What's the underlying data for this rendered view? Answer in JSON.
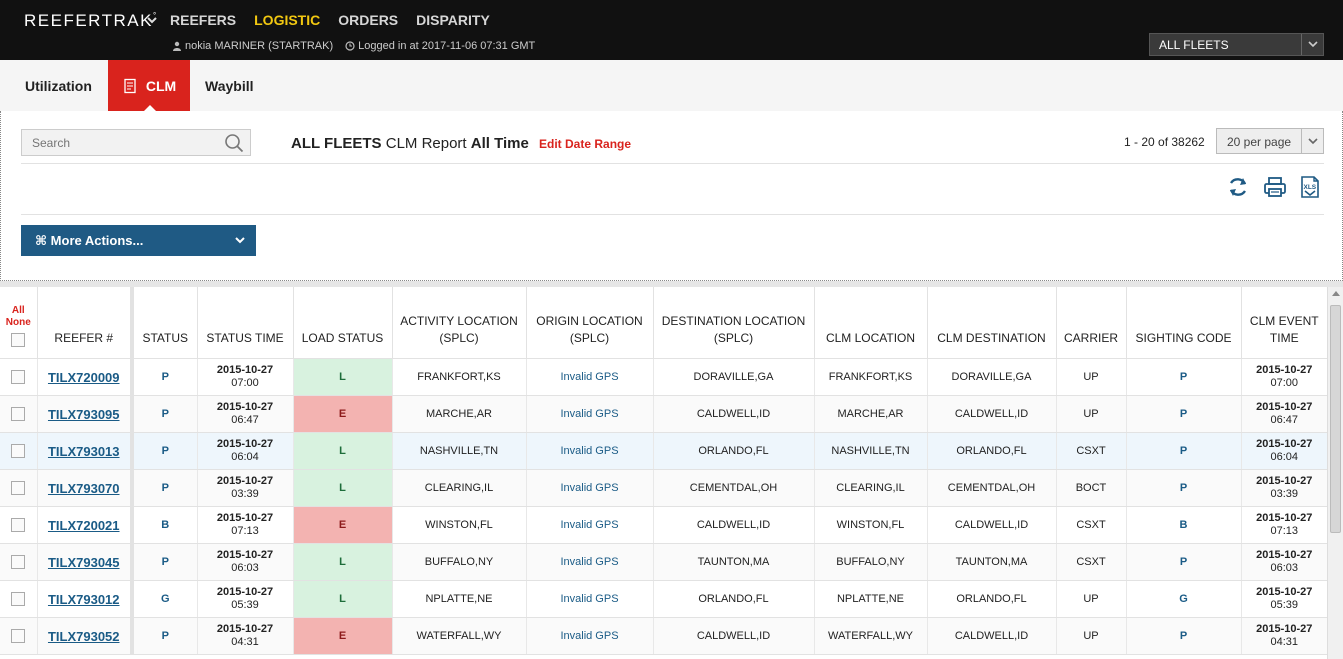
{
  "header": {
    "brand": "REEFERTRAK",
    "brand_mark": "°",
    "nav": [
      "REEFERS",
      "LOGISTIC",
      "ORDERS",
      "DISPARITY"
    ],
    "active_nav": "LOGISTIC",
    "user": "nokia MARINER (STARTRAK)",
    "login": "Logged in at 2017-11-06 07:31 GMT",
    "fleet_select": "ALL FLEETS"
  },
  "tabs": {
    "utilization": "Utilization",
    "clm": "CLM",
    "waybill": "Waybill",
    "active": "CLM"
  },
  "toolbar": {
    "search_placeholder": "Search",
    "title_fleet": "ALL FLEETS",
    "title_mid": "CLM Report",
    "title_range": "All Time",
    "edit_range": "Edit Date Range",
    "pager": "1 - 20 of 38262",
    "per_page": "20 per page",
    "more_actions": "⌘ More Actions..."
  },
  "table": {
    "select_all": "All",
    "select_none": "None",
    "headers": {
      "reefer": "REEFER #",
      "status": "STATUS",
      "status_time": "STATUS TIME",
      "load_status": "LOAD STATUS",
      "activity": [
        "ACTIVITY LOCATION",
        "(SPLC)"
      ],
      "origin": [
        "ORIGIN LOCATION",
        "(SPLC)"
      ],
      "destination": [
        "DESTINATION LOCATION",
        "(SPLC)"
      ],
      "clm_location": "CLM LOCATION",
      "clm_destination": "CLM DESTINATION",
      "carrier": "CARRIER",
      "sighting": "SIGHTING CODE",
      "event_time": [
        "CLM EVENT",
        "TIME"
      ]
    },
    "rows": [
      {
        "id": "TILX720009",
        "status": "P",
        "date": "2015-10-27",
        "time": "07:00",
        "load": "L",
        "activity": "FRANKFORT,KS",
        "origin": "Invalid GPS",
        "dest": "DORAVILLE,GA",
        "clm_loc": "FRANKFORT,KS",
        "clm_dest": "DORAVILLE,GA",
        "carrier": "UP",
        "sighting": "P",
        "ev_date": "2015-10-27",
        "ev_time": "07:00"
      },
      {
        "id": "TILX793095",
        "status": "P",
        "date": "2015-10-27",
        "time": "06:47",
        "load": "E",
        "activity": "MARCHE,AR",
        "origin": "Invalid GPS",
        "dest": "CALDWELL,ID",
        "clm_loc": "MARCHE,AR",
        "clm_dest": "CALDWELL,ID",
        "carrier": "UP",
        "sighting": "P",
        "ev_date": "2015-10-27",
        "ev_time": "06:47"
      },
      {
        "id": "TILX793013",
        "status": "P",
        "date": "2015-10-27",
        "time": "06:04",
        "load": "L",
        "activity": "NASHVILLE,TN",
        "origin": "Invalid GPS",
        "dest": "ORLANDO,FL",
        "clm_loc": "NASHVILLE,TN",
        "clm_dest": "ORLANDO,FL",
        "carrier": "CSXT",
        "sighting": "P",
        "ev_date": "2015-10-27",
        "ev_time": "06:04"
      },
      {
        "id": "TILX793070",
        "status": "P",
        "date": "2015-10-27",
        "time": "03:39",
        "load": "L",
        "activity": "CLEARING,IL",
        "origin": "Invalid GPS",
        "dest": "CEMENTDAL,OH",
        "clm_loc": "CLEARING,IL",
        "clm_dest": "CEMENTDAL,OH",
        "carrier": "BOCT",
        "sighting": "P",
        "ev_date": "2015-10-27",
        "ev_time": "03:39"
      },
      {
        "id": "TILX720021",
        "status": "B",
        "date": "2015-10-27",
        "time": "07:13",
        "load": "E",
        "activity": "WINSTON,FL",
        "origin": "Invalid GPS",
        "dest": "CALDWELL,ID",
        "clm_loc": "WINSTON,FL",
        "clm_dest": "CALDWELL,ID",
        "carrier": "CSXT",
        "sighting": "B",
        "ev_date": "2015-10-27",
        "ev_time": "07:13"
      },
      {
        "id": "TILX793045",
        "status": "P",
        "date": "2015-10-27",
        "time": "06:03",
        "load": "L",
        "activity": "BUFFALO,NY",
        "origin": "Invalid GPS",
        "dest": "TAUNTON,MA",
        "clm_loc": "BUFFALO,NY",
        "clm_dest": "TAUNTON,MA",
        "carrier": "CSXT",
        "sighting": "P",
        "ev_date": "2015-10-27",
        "ev_time": "06:03"
      },
      {
        "id": "TILX793012",
        "status": "G",
        "date": "2015-10-27",
        "time": "05:39",
        "load": "L",
        "activity": "NPLATTE,NE",
        "origin": "Invalid GPS",
        "dest": "ORLANDO,FL",
        "clm_loc": "NPLATTE,NE",
        "clm_dest": "ORLANDO,FL",
        "carrier": "UP",
        "sighting": "G",
        "ev_date": "2015-10-27",
        "ev_time": "05:39"
      },
      {
        "id": "TILX793052",
        "status": "P",
        "date": "2015-10-27",
        "time": "04:31",
        "load": "E",
        "activity": "WATERFALL,WY",
        "origin": "Invalid GPS",
        "dest": "CALDWELL,ID",
        "clm_loc": "WATERFALL,WY",
        "clm_dest": "CALDWELL,ID",
        "carrier": "UP",
        "sighting": "P",
        "ev_date": "2015-10-27",
        "ev_time": "04:31"
      }
    ],
    "highlight_row": 2
  },
  "icons": {
    "user": "user-icon",
    "clock": "clock-icon",
    "search": "search-icon",
    "refresh": "refresh-icon",
    "print": "print-icon",
    "excel": "xls-export-icon",
    "clm_tab": "document-icon",
    "dropdown": "chevron-down-icon"
  },
  "colors": {
    "accent_red": "#d9231d",
    "nav_active": "#f2c811",
    "link_blue": "#1a5b86",
    "button_blue": "#1f5a84",
    "loaded": "#d8f2df",
    "empty": "#f3b3b1"
  }
}
